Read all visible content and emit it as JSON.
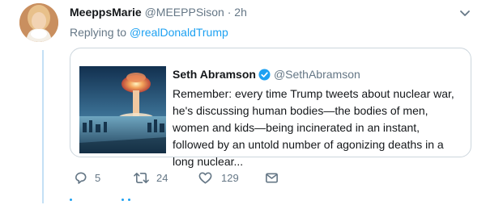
{
  "tweet": {
    "author_name": "MeeppsMarie",
    "author_handle": "@MEEPPSison",
    "separator": "·",
    "time": "2h",
    "replying_to_prefix": "Replying to",
    "replying_to_mention": "@realDonaldTrump"
  },
  "quote": {
    "author_name": "Seth Abramson",
    "author_handle": "@SethAbramson",
    "text": "Remember: every time Trump tweets about nuclear war, he's discussing human bodies—the bodies of men, women and kids—being incinerated in an instant, followed by an untold number of agonizing deaths in a long nuclear...",
    "image_icon": "nuclear-explosion-photo"
  },
  "actions": {
    "replies": "5",
    "retweets": "24",
    "likes": "129"
  },
  "colors": {
    "accent": "#1da1f2",
    "muted": "#657786",
    "border": "#ccd6dd",
    "thread_line": "#c4e0f5"
  }
}
